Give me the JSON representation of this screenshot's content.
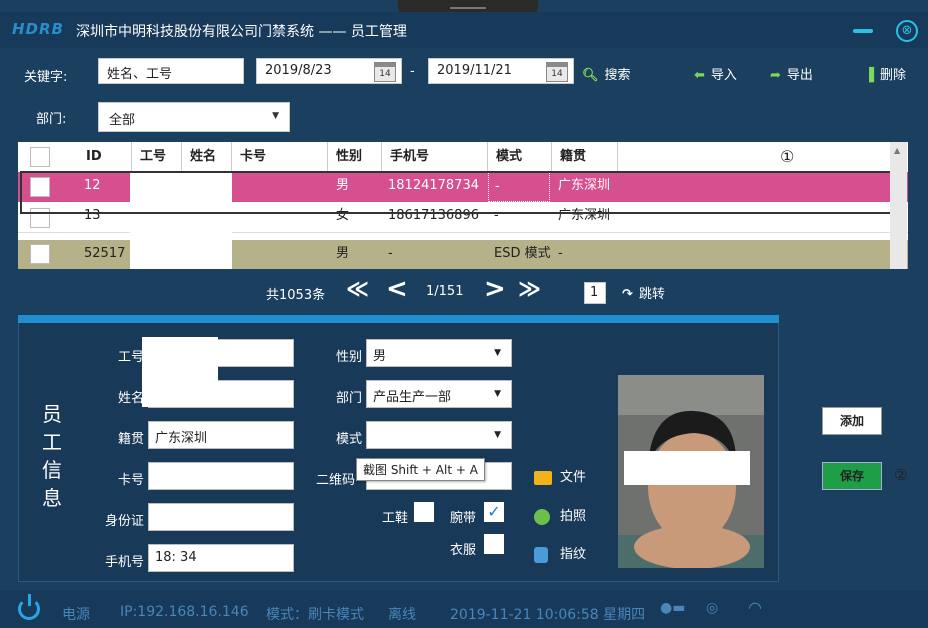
{
  "window": {
    "logo_text": "HDRB",
    "title": "深圳市中明科技股份有限公司门禁系统 —— 员工管理",
    "close_glyph": "⊗"
  },
  "search": {
    "keyword_label": "关键字:",
    "keyword_placeholder": "姓名、工号",
    "date_from": "2019/8/23",
    "date_separator": "-",
    "date_to": "2019/11/21",
    "calendar_day": "14",
    "search_label": "搜索",
    "import_label": "导入",
    "export_label": "导出",
    "delete_label": "删除",
    "dept_label": "部门:",
    "dept_value": "全部"
  },
  "table": {
    "columns": [
      "ID",
      "工号",
      "姓名",
      "卡号",
      "性别",
      "手机号",
      "模式",
      "籍贯"
    ],
    "badge": "①",
    "rows": [
      {
        "id": "12",
        "gender": "男",
        "phone": "18124178734",
        "mode": "-",
        "origin": "广东深圳"
      },
      {
        "id": "13",
        "gender": "女",
        "phone": "18617136896",
        "mode": "-",
        "origin": "广东深圳"
      },
      {
        "id": "52517",
        "gender": "男",
        "phone": "-",
        "mode": "ESD 模式",
        "origin": "-"
      }
    ]
  },
  "pager": {
    "total": "共1053条",
    "first": "≪",
    "prev": "<",
    "page": "1/151",
    "next": ">",
    "last": "≫",
    "jump_value": "1",
    "jump_label": "跳转"
  },
  "detail": {
    "section_title": [
      "员",
      "工",
      "信",
      "息"
    ],
    "labels": {
      "emp_no": "工号",
      "name": "姓名",
      "origin": "籍贯",
      "card": "卡号",
      "id_card": "身份证",
      "phone": "手机号",
      "gender": "性别",
      "dept": "部门",
      "mode": "模式",
      "qrcode": "二维码",
      "shoes": "工鞋",
      "wrist": "腕带",
      "clothes": "衣服"
    },
    "values": {
      "origin": "广东深圳",
      "phone": "18:          34",
      "gender": "男",
      "dept": "产品生产一部",
      "mode": ""
    },
    "tooltip": "截图 Shift + Alt + A",
    "actions": {
      "file": "文件",
      "photo": "拍照",
      "fingerprint": "指纹"
    },
    "add_label": "添加",
    "save_label": "保存",
    "badge": "②"
  },
  "status": {
    "power": "电源",
    "ip": "IP:192.168.16.146",
    "mode": "模式：刷卡模式",
    "conn": "离线",
    "datetime": "2019-11-21 10:06:58 星期四"
  }
}
